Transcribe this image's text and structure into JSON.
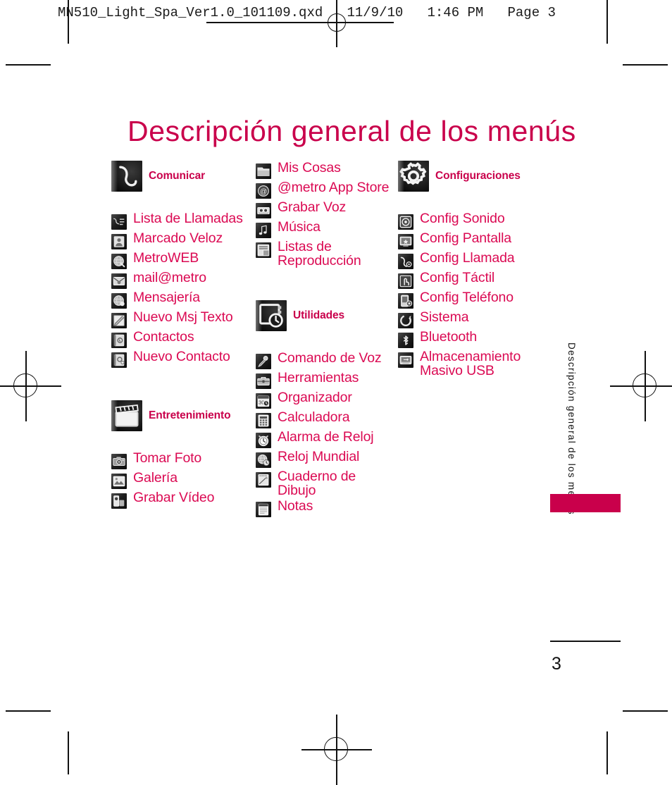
{
  "print_header": {
    "text": "MN510_Light_Spa_Ver1.0_101109.qxd   11/9/10   1:46 PM   Page 3"
  },
  "page_title": "Descripción general de los menús",
  "side_running_head": "Descripción general de los menús",
  "page_number": "3",
  "colors": {
    "accent": "#C9004B",
    "item_text": "#DB0A53",
    "ink": "#111111"
  },
  "columns": [
    {
      "groups": [
        {
          "category": {
            "label": "Comunicar",
            "icon": "phone-handset-icon"
          },
          "items": [
            {
              "label": "Lista de Llamadas",
              "icon": "call-log-icon"
            },
            {
              "label": "Marcado Veloz",
              "icon": "speed-dial-person-icon"
            },
            {
              "label": "MetroWEB",
              "icon": "globe-browser-icon"
            },
            {
              "label": "mail@metro",
              "icon": "envelope-mail-icon"
            },
            {
              "label": "Mensajería",
              "icon": "messaging-globe-icon"
            },
            {
              "label": "Nuevo Msj Texto",
              "icon": "new-text-message-icon"
            },
            {
              "label": "Contactos",
              "icon": "contacts-book-icon"
            },
            {
              "label": "Nuevo Contacto",
              "icon": "new-contact-icon"
            }
          ]
        },
        {
          "category": {
            "label": "Entretenimiento",
            "icon": "film-clapper-icon"
          },
          "items": [
            {
              "label": "Tomar Foto",
              "icon": "camera-icon"
            },
            {
              "label": "Galería",
              "icon": "gallery-icon"
            },
            {
              "label": "Grabar Vídeo",
              "icon": "camcorder-icon"
            }
          ]
        }
      ]
    },
    {
      "groups": [
        {
          "category": null,
          "items": [
            {
              "label": "Mis Cosas",
              "icon": "folder-icon"
            },
            {
              "label": "@metro App Store",
              "icon": "at-store-icon"
            },
            {
              "label": "Grabar Voz",
              "icon": "voice-recorder-icon"
            },
            {
              "label": "Música",
              "icon": "music-note-icon"
            },
            {
              "label": "Listas de Reproducción",
              "icon": "playlist-icon"
            }
          ]
        },
        {
          "category": {
            "label": "Utilidades",
            "icon": "utilities-clock-icon"
          },
          "items": [
            {
              "label": "Comando de Voz",
              "icon": "microphone-icon"
            },
            {
              "label": "Herramientas",
              "icon": "toolbox-icon"
            },
            {
              "label": "Organizador",
              "icon": "calendar-organizer-icon"
            },
            {
              "label": "Calculadora",
              "icon": "calculator-icon"
            },
            {
              "label": "Alarma de Reloj",
              "icon": "alarm-clock-icon"
            },
            {
              "label": "Reloj Mundial",
              "icon": "world-clock-icon"
            },
            {
              "label": "Cuaderno de Dibujo",
              "icon": "sketchpad-icon"
            },
            {
              "label": "Notas",
              "icon": "notes-icon"
            }
          ]
        }
      ]
    },
    {
      "groups": [
        {
          "category": {
            "label": "Configuraciones",
            "icon": "gear-icon"
          },
          "items": [
            {
              "label": "Config Sonido",
              "icon": "sound-settings-icon"
            },
            {
              "label": "Config Pantalla",
              "icon": "display-settings-icon"
            },
            {
              "label": "Config Llamada",
              "icon": "call-settings-icon"
            },
            {
              "label": "Config Táctil",
              "icon": "touch-settings-icon"
            },
            {
              "label": "Config Teléfono",
              "icon": "phone-settings-icon"
            },
            {
              "label": "Sistema",
              "icon": "system-icon"
            },
            {
              "label": "Bluetooth",
              "icon": "bluetooth-icon"
            },
            {
              "label": "Almacenamiento Masivo USB",
              "icon": "usb-storage-icon"
            }
          ]
        }
      ]
    }
  ]
}
